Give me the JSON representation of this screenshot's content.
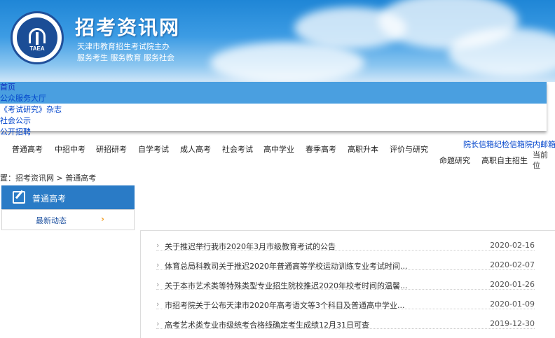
{
  "header": {
    "site_title": "招考资讯网",
    "subtitle": "天津市教育招生考试院主办",
    "slogan": "服务考生 服务教育 服务社会",
    "logo_text": "TAEA"
  },
  "topnav": {
    "items": [
      "首页",
      "公众服务大厅",
      "《考试研究》杂志",
      "社会公示",
      "公开招聘"
    ]
  },
  "categories": {
    "row1": [
      "普通高考",
      "中招中考",
      "研招研考",
      "自学考试",
      "成人高考",
      "社会考试",
      "高中学业",
      "春季高考",
      "高职升本",
      "评价与研究"
    ],
    "row2": [
      "命题研究",
      "高职自主招生"
    ]
  },
  "right_links": "院长信箱纪检信箱院内邮箱",
  "current_position": "当前位",
  "breadcrumb": {
    "prefix": "置：",
    "home": "招考资讯网",
    "sep": " > ",
    "current": "普通高考"
  },
  "sidebar": {
    "heading": "普通高考",
    "items": [
      {
        "label": "最新动态",
        "chevron": "›"
      }
    ]
  },
  "news": [
    {
      "title": "关于推迟举行我市2020年3月市级教育考试的公告",
      "date": "2020-02-16"
    },
    {
      "title": "体育总局科教司关于推迟2020年普通高等学校运动训练专业考试时间...",
      "date": "2020-02-07"
    },
    {
      "title": "关于本市艺术类等特殊类型专业招生院校推迟2020年校考时间的温馨...",
      "date": "2020-01-26"
    },
    {
      "title": "市招考院关于公布天津市2020年高考语文等3个科目及普通高中学业...",
      "date": "2020-01-09"
    },
    {
      "title": "高考艺术类专业市级统考合格线确定考生成绩12月31日可查",
      "date": "2019-12-30"
    }
  ],
  "colors": {
    "header_blue": "#1f86d6",
    "nav_blue": "#4a9fe0",
    "sidebar_blue": "#2a7bc6",
    "accent_orange": "#f29b1f"
  }
}
